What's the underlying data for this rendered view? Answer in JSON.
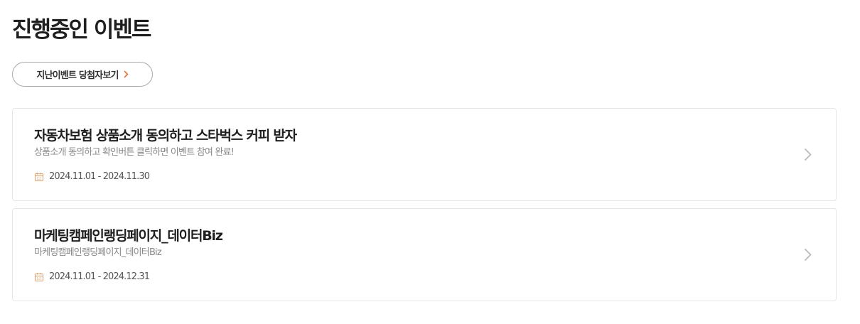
{
  "header": {
    "title": "진행중인 이벤트"
  },
  "past_winners_button": {
    "label": "지난이벤트 당첨자보기",
    "icon": "chevron-right-icon",
    "accent_color": "#e8722e"
  },
  "events": [
    {
      "title": "자동차보험 상품소개 동의하고 스타벅스 커피 받자",
      "description": "상품소개 동의하고 확인버튼 클릭하면 이벤트 참여 완료!",
      "period": "2024.11.01 - 2024.11.30",
      "date_icon": "calendar-icon",
      "arrow_icon": "chevron-right-icon"
    },
    {
      "title": "마케팅캠페인랭딩페이지_데이터Biz",
      "description": "마케팅캠페인랭딩페이지_데이터Biz",
      "period": "2024.11.01 - 2024.12.31",
      "date_icon": "calendar-icon",
      "arrow_icon": "chevron-right-icon"
    }
  ],
  "colors": {
    "calendar_icon": "#e8a06a",
    "card_border": "#e6e6e6",
    "chevron_gray": "#b5b5b5"
  }
}
